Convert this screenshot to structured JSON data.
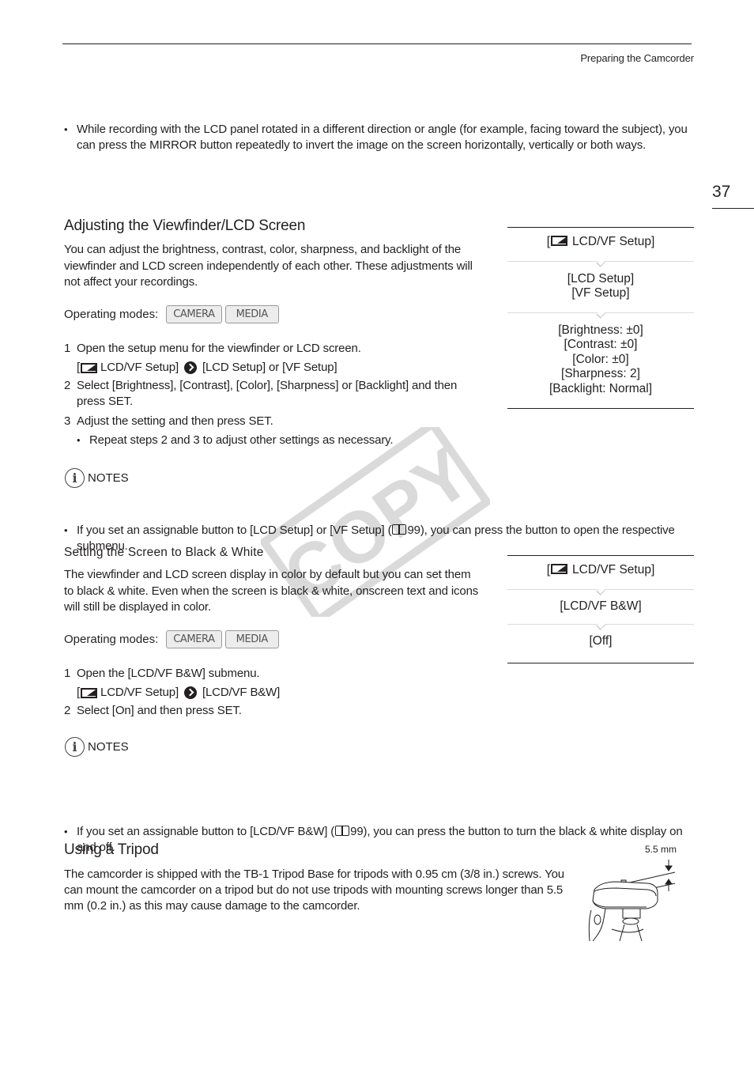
{
  "header": {
    "running_title": "Preparing the Camcorder",
    "page_number": "37"
  },
  "intro_bullet": "While recording with the LCD panel rotated in a different direction or angle (for example, facing toward the subject), you can press the MIRROR button repeatedly to invert the image on the screen horizontally, vertically or both ways.",
  "adjust_section": {
    "title": "Adjusting the Viewfinder/LCD Screen",
    "description": "You can adjust the brightness, contrast, color, sharpness, and backlight of the viewfinder and LCD screen independently of each other. These adjustments will not affect your recordings.",
    "operating_modes_label": "Operating modes:",
    "modes": [
      "CAMERA",
      "MEDIA"
    ],
    "steps": [
      {
        "num": "1",
        "text": "Open the setup menu for the viewfinder or LCD screen.",
        "path_start": "[",
        "path_menu": "LCD/VF Setup]",
        "path_target": "[LCD Setup] or [VF Setup]"
      },
      {
        "num": "2",
        "text": "Select [Brightness], [Contrast], [Color], [Sharpness] or [Backlight] and then press SET."
      },
      {
        "num": "3",
        "text": "Adjust the setting and then press SET.",
        "sub_bullet": "Repeat steps 2 and 3 to adjust other settings as necessary."
      }
    ],
    "notes_label": "NOTES",
    "note_before": "If you set an assignable button to [LCD Setup] or [VF Setup] (",
    "note_page": "99",
    "note_after": "), you can press the button to open the respective submenu.",
    "menu_flow": [
      {
        "prefix": "[",
        "label": "LCD/VF Setup]"
      },
      {
        "lines": [
          "[LCD Setup]",
          "[VF Setup]"
        ]
      },
      {
        "lines": [
          "[Brightness: ±0]",
          "[Contrast: ±0]",
          "[Color: ±0]",
          "[Sharpness: 2]",
          "[Backlight: Normal]"
        ]
      }
    ]
  },
  "bw_section": {
    "title": "Setting the Screen to Black & White",
    "description": "The viewfinder and LCD screen display in color by default but you can set them to black & white. Even when the screen is black & white, onscreen text and icons will still be displayed in color.",
    "operating_modes_label": "Operating modes:",
    "modes": [
      "CAMERA",
      "MEDIA"
    ],
    "steps": [
      {
        "num": "1",
        "text": "Open the [LCD/VF B&W] submenu.",
        "path_start": "[",
        "path_menu": "LCD/VF Setup]",
        "path_target": "[LCD/VF B&W]"
      },
      {
        "num": "2",
        "text": "Select [On] and then press SET."
      }
    ],
    "notes_label": "NOTES",
    "note_before": "If you set an assignable button to [LCD/VF B&W] (",
    "note_page": "99",
    "note_after": "), you can press the button to turn the black & white display on and off.",
    "menu_flow": [
      {
        "prefix": "[",
        "label": "LCD/VF Setup]"
      },
      {
        "lines": [
          "[LCD/VF B&W]"
        ]
      },
      {
        "lines": [
          "[Off]"
        ]
      }
    ]
  },
  "tripod_section": {
    "title": "Using a Tripod",
    "description": "The camcorder is shipped with the TB-1 Tripod Base for tripods with 0.95 cm (3/8 in.) screws. You can mount the camcorder on a tripod but do not use tripods with mounting screws longer than 5.5 mm (0.2 in.) as this may cause damage to the camcorder.",
    "figure_label": "5.5 mm"
  },
  "watermark": "COPY"
}
